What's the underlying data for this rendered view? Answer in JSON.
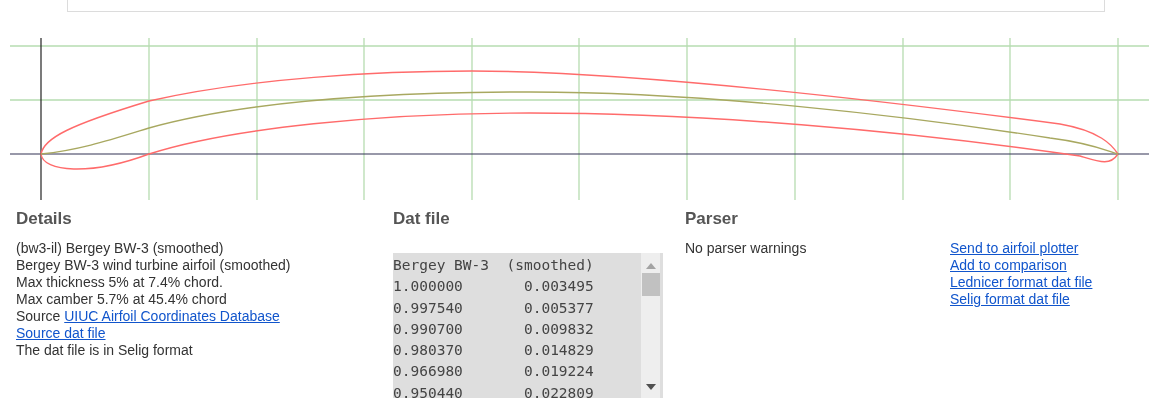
{
  "details": {
    "heading": "Details",
    "lines": [
      {
        "kind": "text",
        "text": "(bw3-il) Bergey BW-3 (smoothed)"
      },
      {
        "kind": "text",
        "text": "Bergey BW-3 wind turbine airfoil (smoothed)"
      },
      {
        "kind": "text",
        "text": "Max thickness 5% at 7.4% chord."
      },
      {
        "kind": "text",
        "text": "Max camber 5.7% at 45.4% chord"
      },
      {
        "kind": "labelled_link",
        "label": "Source",
        "link": "UIUC Airfoil Coordinates Database"
      },
      {
        "kind": "link",
        "text": "Source dat file"
      },
      {
        "kind": "text",
        "text": "The dat file is in Selig format"
      }
    ]
  },
  "dat_file": {
    "heading": "Dat file",
    "lines": [
      "Bergey BW-3  (smoothed)",
      "1.000000       0.003495",
      "0.997540       0.005377",
      "0.990700       0.009832",
      "0.980370       0.014829",
      "0.966980       0.019224",
      "0.950440       0.022809"
    ]
  },
  "parser": {
    "heading": "Parser",
    "message": "No parser warnings",
    "links": [
      "Send to airfoil plotter",
      "Add to comparison",
      "Lednicer format dat file",
      "Selig format dat file"
    ]
  }
}
